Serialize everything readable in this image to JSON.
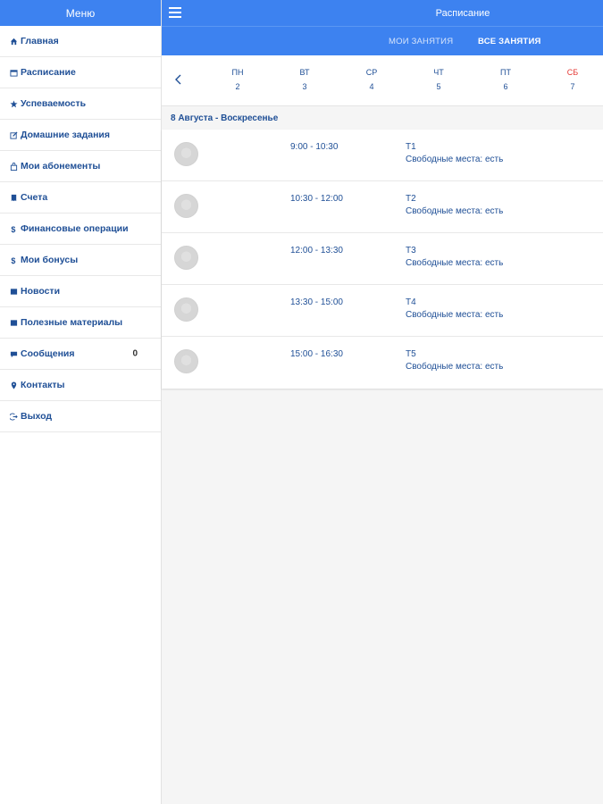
{
  "sidebar": {
    "title": "Меню",
    "items": [
      {
        "label": "Главная",
        "icon": "home-icon"
      },
      {
        "label": "Расписание",
        "icon": "calendar-icon"
      },
      {
        "label": "Успеваемость",
        "icon": "star-icon"
      },
      {
        "label": "Домашние задания",
        "icon": "edit-icon"
      },
      {
        "label": "Мои абонементы",
        "icon": "bag-icon"
      },
      {
        "label": "Счета",
        "icon": "invoice-icon"
      },
      {
        "label": "Финансовые операции",
        "icon": "dollar-icon"
      },
      {
        "label": "Мои бонусы",
        "icon": "bonus-icon"
      },
      {
        "label": "Новости",
        "icon": "news-icon"
      },
      {
        "label": "Полезные материалы",
        "icon": "materials-icon"
      },
      {
        "label": "Сообщения",
        "icon": "message-icon",
        "badge": "0"
      },
      {
        "label": "Контакты",
        "icon": "map-pin-icon"
      },
      {
        "label": "Выход",
        "icon": "logout-icon"
      }
    ]
  },
  "topbar": {
    "title": "Расписание",
    "menu_icon": "hamburger-icon",
    "color": "#3d82f0"
  },
  "tabs": {
    "my": "МОИ ЗАНЯТИЯ",
    "all": "ВСЕ ЗАНЯТИЯ",
    "active": "all"
  },
  "week": {
    "prev_icon": "chevron-left-icon",
    "days": [
      {
        "name": "ПН",
        "date": "2",
        "weekend": false
      },
      {
        "name": "ВТ",
        "date": "3",
        "weekend": false
      },
      {
        "name": "СР",
        "date": "4",
        "weekend": false
      },
      {
        "name": "ЧТ",
        "date": "5",
        "weekend": false
      },
      {
        "name": "ПТ",
        "date": "6",
        "weekend": false
      },
      {
        "name": "СБ",
        "date": "7",
        "weekend": true
      }
    ]
  },
  "schedule": {
    "date_header": "8 Августа - Воскресенье",
    "lessons": [
      {
        "time": "9:00 - 10:30",
        "name": "T1",
        "seats": "Свободные места: есть"
      },
      {
        "time": "10:30 - 12:00",
        "name": "T2",
        "seats": "Свободные места: есть"
      },
      {
        "time": "12:00 - 13:30",
        "name": "T3",
        "seats": "Свободные места: есть"
      },
      {
        "time": "13:30 - 15:00",
        "name": "T4",
        "seats": "Свободные места: есть"
      },
      {
        "time": "15:00 - 16:30",
        "name": "T5",
        "seats": "Свободные места: есть"
      }
    ]
  },
  "colors": {
    "accent": "#3d82f0",
    "text": "#1f4f96",
    "weekend": "#e53935"
  }
}
